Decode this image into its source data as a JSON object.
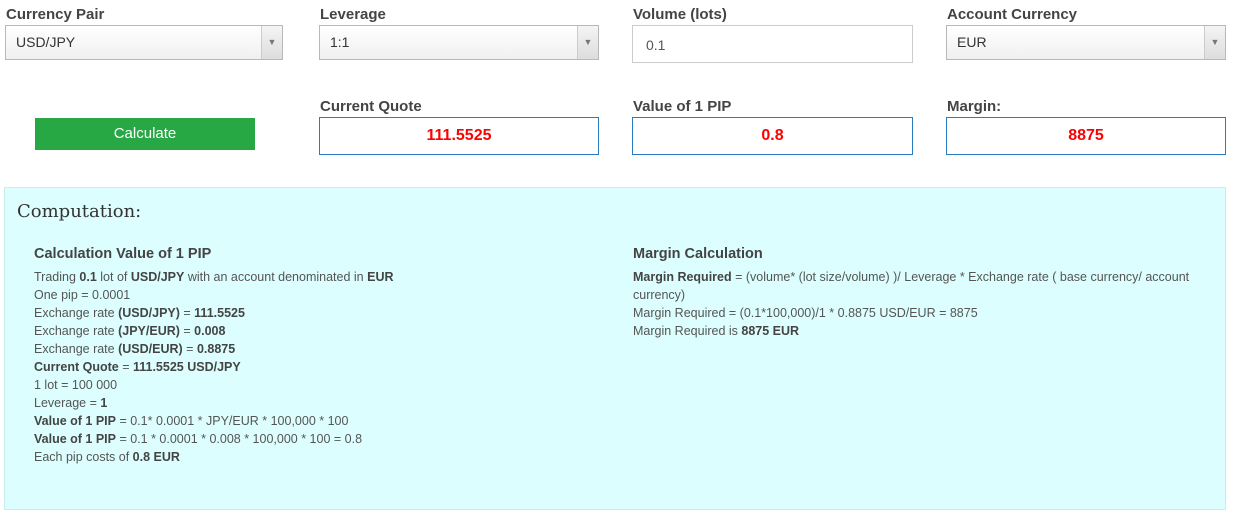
{
  "fields": {
    "currency_pair": {
      "label": "Currency Pair",
      "value": "USD/JPY"
    },
    "leverage": {
      "label": "Leverage",
      "value": "1:1"
    },
    "volume": {
      "label": "Volume (lots)",
      "value": "0.1"
    },
    "account_currency": {
      "label": "Account Currency",
      "value": "EUR"
    }
  },
  "calculate_label": "Calculate",
  "results": {
    "current_quote": {
      "label": "Current Quote",
      "value": "111.5525"
    },
    "pip_value": {
      "label": "Value of 1 PIP",
      "value": "0.8"
    },
    "margin": {
      "label": "Margin:",
      "value": "8875"
    }
  },
  "computation": {
    "title": "Computation:",
    "pip": {
      "heading": "Calculation Value of 1 PIP",
      "lines": [
        [
          {
            "t": "Trading "
          },
          {
            "t": "0.1",
            "b": 1
          },
          {
            "t": " lot of "
          },
          {
            "t": "USD/JPY",
            "b": 1
          },
          {
            "t": " with an account denominated in "
          },
          {
            "t": "EUR",
            "b": 1
          }
        ],
        [
          {
            "t": "One pip = 0.0001"
          }
        ],
        [
          {
            "t": "Exchange rate "
          },
          {
            "t": "(USD/JPY)",
            "b": 1
          },
          {
            "t": " = "
          },
          {
            "t": "111.5525",
            "b": 1
          }
        ],
        [
          {
            "t": "Exchange rate "
          },
          {
            "t": "(JPY/EUR)",
            "b": 1
          },
          {
            "t": " = "
          },
          {
            "t": "0.008",
            "b": 1
          }
        ],
        [
          {
            "t": "Exchange rate "
          },
          {
            "t": "(USD/EUR)",
            "b": 1
          },
          {
            "t": " = "
          },
          {
            "t": "0.8875",
            "b": 1
          }
        ],
        [
          {
            "t": "Current Quote",
            "b": 1
          },
          {
            "t": " = "
          },
          {
            "t": "111.5525 USD/JPY",
            "b": 1
          }
        ],
        [
          {
            "t": "1 lot = 100 000"
          }
        ],
        [
          {
            "t": "Leverage = "
          },
          {
            "t": "1",
            "b": 1
          }
        ],
        [
          {
            "t": "Value of 1 PIP",
            "b": 1
          },
          {
            "t": " = 0.1* 0.0001 * JPY/EUR * 100,000 * 100"
          }
        ],
        [
          {
            "t": "Value of 1 PIP",
            "b": 1
          },
          {
            "t": " = 0.1 * 0.0001 * 0.008 * 100,000 * 100 = 0.8"
          }
        ],
        [
          {
            "t": "Each pip costs of "
          },
          {
            "t": "0.8 EUR",
            "b": 1
          }
        ]
      ]
    },
    "margin": {
      "heading": "Margin Calculation",
      "lines": [
        [
          {
            "t": "Margin Required",
            "b": 1
          },
          {
            "t": " = (volume* (lot size/volume) )/ Leverage * Exchange rate ( base currency/ account currency)"
          }
        ],
        [
          {
            "t": "Margin Required = (0.1*100,000)/1 * 0.8875 USD/EUR = 8875"
          }
        ],
        [
          {
            "t": "Margin Required is "
          },
          {
            "t": "8875 EUR",
            "b": 1
          }
        ]
      ]
    }
  }
}
